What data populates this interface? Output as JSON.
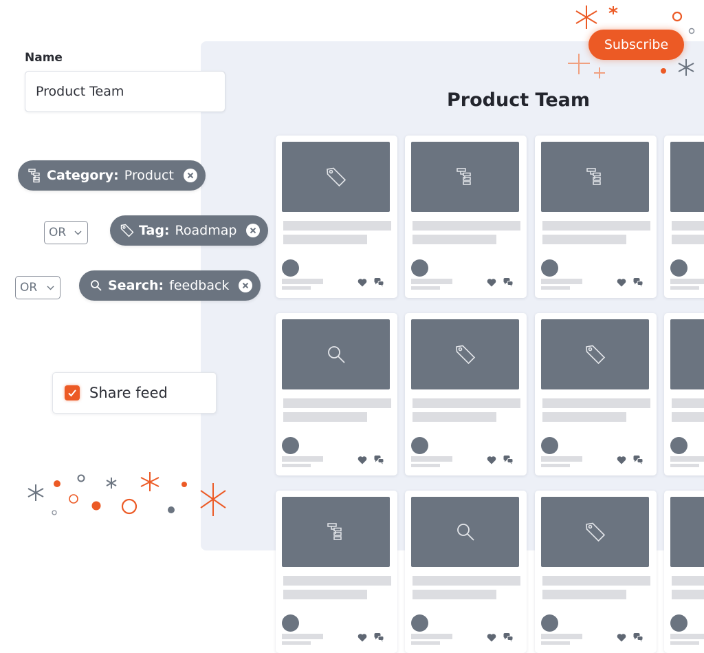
{
  "form": {
    "name_label": "Name",
    "name_value": "Product Team",
    "filters": [
      {
        "icon": "hierarchy-icon",
        "key": "Category:",
        "value": "Product"
      },
      {
        "icon": "tag-icon",
        "key": "Tag:",
        "value": "Roadmap"
      },
      {
        "icon": "search-icon",
        "key": "Search:",
        "value": "feedback"
      }
    ],
    "operators": [
      {
        "selected": "OR"
      },
      {
        "selected": "OR"
      }
    ],
    "share_feed": {
      "label": "Share feed",
      "checked": true
    }
  },
  "feed": {
    "title": "Product Team",
    "subscribe_label": "Subscribe",
    "cards": [
      {
        "thumb_icon": "tag-icon"
      },
      {
        "thumb_icon": "hierarchy-icon"
      },
      {
        "thumb_icon": "hierarchy-icon"
      },
      {
        "thumb_icon": "none"
      },
      {
        "thumb_icon": "search-icon"
      },
      {
        "thumb_icon": "tag-icon"
      },
      {
        "thumb_icon": "tag-icon"
      },
      {
        "thumb_icon": "none"
      },
      {
        "thumb_icon": "hierarchy-icon"
      },
      {
        "thumb_icon": "search-icon"
      },
      {
        "thumb_icon": "tag-icon"
      },
      {
        "thumb_icon": "none"
      }
    ]
  },
  "colors": {
    "accent": "#ec5a25",
    "chip": "#6b7480",
    "panel": "#edf0f7",
    "placeholder": "#dcdde1"
  }
}
